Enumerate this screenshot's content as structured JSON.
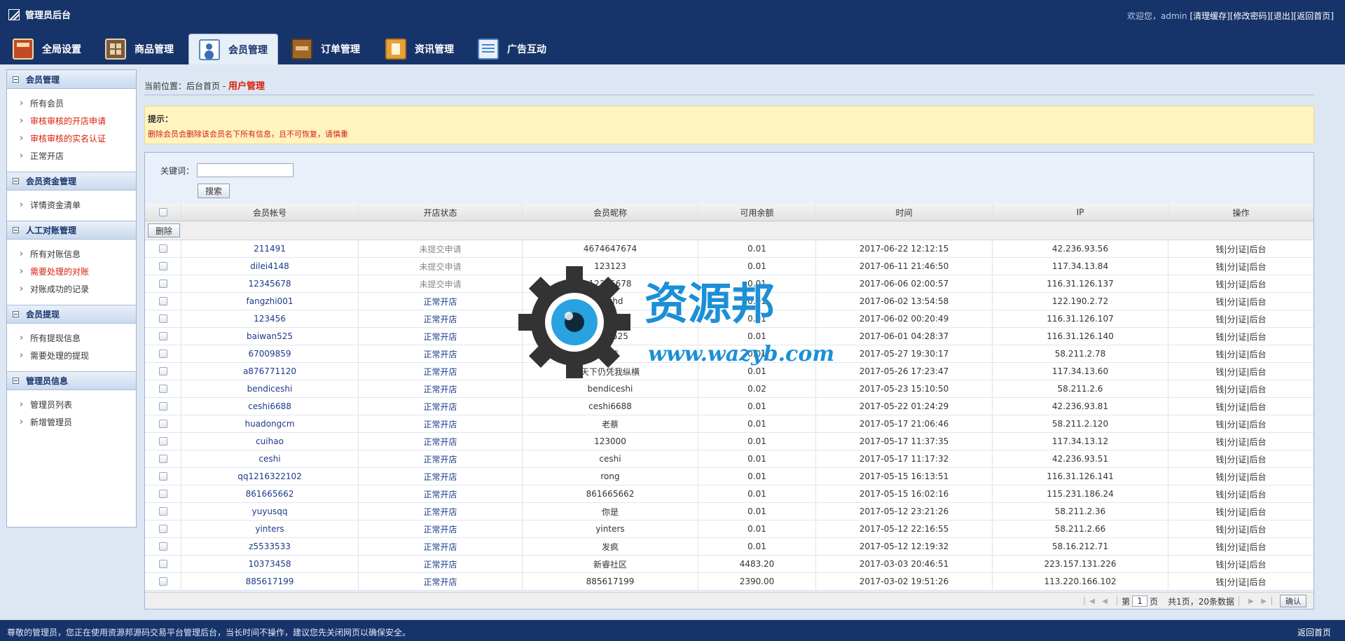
{
  "app": {
    "title": "管理员后台",
    "welcome": "欢迎您，admin",
    "links": [
      "清理缓存",
      "修改密码",
      "退出",
      "返回首页"
    ]
  },
  "nav": {
    "tabs": [
      {
        "label": "全局设置",
        "icon": "settings-icon"
      },
      {
        "label": "商品管理",
        "icon": "goods-icon"
      },
      {
        "label": "会员管理",
        "icon": "member-icon"
      },
      {
        "label": "订单管理",
        "icon": "order-icon"
      },
      {
        "label": "资讯管理",
        "icon": "news-icon"
      },
      {
        "label": "广告互动",
        "icon": "ads-icon"
      }
    ],
    "active": "会员管理"
  },
  "sidebar": {
    "groups": [
      {
        "title": "会员管理",
        "items": [
          "所有会员",
          "审核审核的开店申请",
          "审核审核的实名认证",
          "正常开店"
        ]
      },
      {
        "title": "会员资金管理",
        "items": [
          "详情资金清单"
        ]
      },
      {
        "title": "人工对账管理",
        "items": [
          "所有对账信息",
          "需要处理的对账",
          "对账成功的记录"
        ]
      },
      {
        "title": "会员提现",
        "items": [
          "所有提现信息",
          "需要处理的提现"
        ]
      },
      {
        "title": "管理员信息",
        "items": [
          "管理员列表",
          "新增管理员"
        ]
      }
    ]
  },
  "breadcrumb": {
    "prefix": "当前位置：",
    "home": "后台首页",
    "sep": " - ",
    "current": "用户管理"
  },
  "notice": {
    "title": "提示：",
    "text": "删除会员会删除该会员名下所有信息，且不可恢复，请慎重"
  },
  "search": {
    "label": "关键词：",
    "value": "",
    "button": "搜索"
  },
  "table": {
    "columns": [
      "会员帐号",
      "开店状态",
      "会员昵称",
      "可用余额",
      "时间",
      "IP",
      "操作"
    ],
    "delete_label": "删除",
    "ops": "钱|分|证|后台",
    "rows": [
      {
        "account": "211491",
        "status": "未提交申请",
        "nick": "4674647674",
        "balance": "0.01",
        "time": "2017-06-22 12:12:15",
        "ip": "42.236.93.56"
      },
      {
        "account": "dilei4148",
        "status": "未提交申请",
        "nick": "123123",
        "balance": "0.01",
        "time": "2017-06-11 21:46:50",
        "ip": "117.34.13.84"
      },
      {
        "account": "12345678",
        "status": "未提交申请",
        "nick": "12345678",
        "balance": "0.01",
        "time": "2017-06-06 02:00:57",
        "ip": "116.31.126.137"
      },
      {
        "account": "fangzhi001",
        "status": "正常开店",
        "nick": "jinghd",
        "balance": "0.01",
        "time": "2017-06-02 13:54:58",
        "ip": "122.190.2.72"
      },
      {
        "account": "123456",
        "status": "正常开店",
        "nick": "123456",
        "balance": "0.01",
        "time": "2017-06-02 00:20:49",
        "ip": "116.31.126.107"
      },
      {
        "account": "baiwan525",
        "status": "正常开店",
        "nick": "liuyu525",
        "balance": "0.01",
        "time": "2017-06-01 04:28:37",
        "ip": "116.31.126.140"
      },
      {
        "account": "67009859",
        "status": "正常开店",
        "nick": "老蔡",
        "balance": "0.01",
        "time": "2017-05-27 19:30:17",
        "ip": "58.211.2.78"
      },
      {
        "account": "a876771120",
        "status": "正常开店",
        "nick": "天下仍凭我纵横",
        "balance": "0.01",
        "time": "2017-05-26 17:23:47",
        "ip": "117.34.13.60"
      },
      {
        "account": "bendiceshi",
        "status": "正常开店",
        "nick": "bendiceshi",
        "balance": "0.02",
        "time": "2017-05-23 15:10:50",
        "ip": "58.211.2.6"
      },
      {
        "account": "ceshi6688",
        "status": "正常开店",
        "nick": "ceshi6688",
        "balance": "0.01",
        "time": "2017-05-22 01:24:29",
        "ip": "42.236.93.81"
      },
      {
        "account": "huadongcm",
        "status": "正常开店",
        "nick": "老蔡",
        "balance": "0.01",
        "time": "2017-05-17 21:06:46",
        "ip": "58.211.2.120"
      },
      {
        "account": "cuihao",
        "status": "正常开店",
        "nick": "123000",
        "balance": "0.01",
        "time": "2017-05-17 11:37:35",
        "ip": "117.34.13.12"
      },
      {
        "account": "ceshi",
        "status": "正常开店",
        "nick": "ceshi",
        "balance": "0.01",
        "time": "2017-05-17 11:17:32",
        "ip": "42.236.93.51"
      },
      {
        "account": "qq1216322102",
        "status": "正常开店",
        "nick": "rong",
        "balance": "0.01",
        "time": "2017-05-15 16:13:51",
        "ip": "116.31.126.141"
      },
      {
        "account": "861665662",
        "status": "正常开店",
        "nick": "861665662",
        "balance": "0.01",
        "time": "2017-05-15 16:02:16",
        "ip": "115.231.186.24"
      },
      {
        "account": "yuyusqq",
        "status": "正常开店",
        "nick": "你是",
        "balance": "0.01",
        "time": "2017-05-12 23:21:26",
        "ip": "58.211.2.36"
      },
      {
        "account": "yinters",
        "status": "正常开店",
        "nick": "yinters",
        "balance": "0.01",
        "time": "2017-05-12 22:16:55",
        "ip": "58.211.2.66"
      },
      {
        "account": "z5533533",
        "status": "正常开店",
        "nick": "发疯",
        "balance": "0.01",
        "time": "2017-05-12 12:19:32",
        "ip": "58.16.212.71"
      },
      {
        "account": "10373458",
        "status": "正常开店",
        "nick": "新睿社区",
        "balance": "4483.20",
        "time": "2017-03-03 20:46:51",
        "ip": "223.157.131.226"
      },
      {
        "account": "885617199",
        "status": "正常开店",
        "nick": "885617199",
        "balance": "2390.00",
        "time": "2017-03-02 19:51:26",
        "ip": "113.220.166.102"
      }
    ]
  },
  "pager": {
    "page_prefix": "第",
    "page": "1",
    "page_suffix": "页",
    "summary": "共1页，20条数据",
    "confirm": "确认"
  },
  "footer": {
    "text": "尊敬的管理员，您正在使用资源邦源码交易平台管理后台，当长时间不操作，建议您先关闭网页以确保安全。",
    "home": "返回首页"
  },
  "watermark": {
    "title": "资源邦",
    "url": "www.wazyb.com"
  },
  "colors": {
    "header_bg": "#17346a",
    "accent_red": "#d81e06",
    "link_blue": "#1b3a8a",
    "notice_bg": "#fff4c0"
  }
}
